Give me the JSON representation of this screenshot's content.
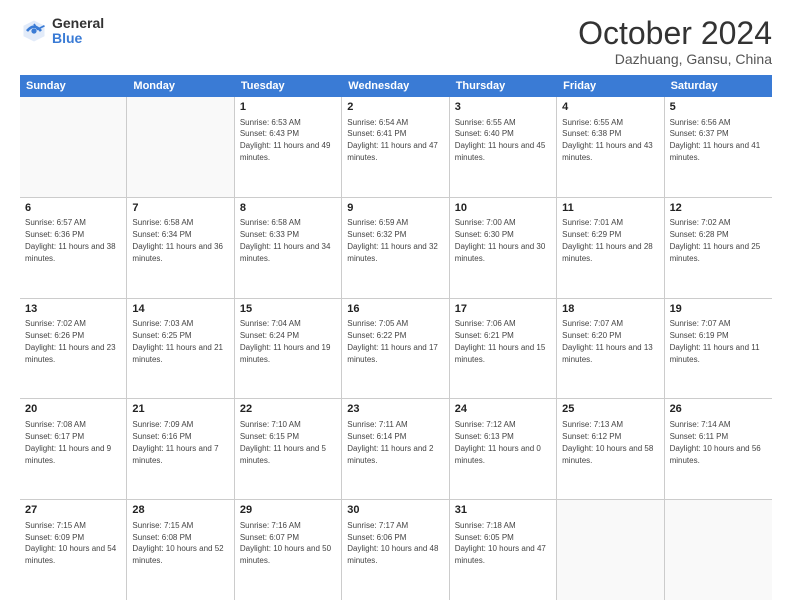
{
  "logo": {
    "general": "General",
    "blue": "Blue"
  },
  "title": "October 2024",
  "location": "Dazhuang, Gansu, China",
  "header_days": [
    "Sunday",
    "Monday",
    "Tuesday",
    "Wednesday",
    "Thursday",
    "Friday",
    "Saturday"
  ],
  "weeks": [
    [
      {
        "day": "",
        "info": ""
      },
      {
        "day": "",
        "info": ""
      },
      {
        "day": "1",
        "info": "Sunrise: 6:53 AM\nSunset: 6:43 PM\nDaylight: 11 hours and 49 minutes."
      },
      {
        "day": "2",
        "info": "Sunrise: 6:54 AM\nSunset: 6:41 PM\nDaylight: 11 hours and 47 minutes."
      },
      {
        "day": "3",
        "info": "Sunrise: 6:55 AM\nSunset: 6:40 PM\nDaylight: 11 hours and 45 minutes."
      },
      {
        "day": "4",
        "info": "Sunrise: 6:55 AM\nSunset: 6:38 PM\nDaylight: 11 hours and 43 minutes."
      },
      {
        "day": "5",
        "info": "Sunrise: 6:56 AM\nSunset: 6:37 PM\nDaylight: 11 hours and 41 minutes."
      }
    ],
    [
      {
        "day": "6",
        "info": "Sunrise: 6:57 AM\nSunset: 6:36 PM\nDaylight: 11 hours and 38 minutes."
      },
      {
        "day": "7",
        "info": "Sunrise: 6:58 AM\nSunset: 6:34 PM\nDaylight: 11 hours and 36 minutes."
      },
      {
        "day": "8",
        "info": "Sunrise: 6:58 AM\nSunset: 6:33 PM\nDaylight: 11 hours and 34 minutes."
      },
      {
        "day": "9",
        "info": "Sunrise: 6:59 AM\nSunset: 6:32 PM\nDaylight: 11 hours and 32 minutes."
      },
      {
        "day": "10",
        "info": "Sunrise: 7:00 AM\nSunset: 6:30 PM\nDaylight: 11 hours and 30 minutes."
      },
      {
        "day": "11",
        "info": "Sunrise: 7:01 AM\nSunset: 6:29 PM\nDaylight: 11 hours and 28 minutes."
      },
      {
        "day": "12",
        "info": "Sunrise: 7:02 AM\nSunset: 6:28 PM\nDaylight: 11 hours and 25 minutes."
      }
    ],
    [
      {
        "day": "13",
        "info": "Sunrise: 7:02 AM\nSunset: 6:26 PM\nDaylight: 11 hours and 23 minutes."
      },
      {
        "day": "14",
        "info": "Sunrise: 7:03 AM\nSunset: 6:25 PM\nDaylight: 11 hours and 21 minutes."
      },
      {
        "day": "15",
        "info": "Sunrise: 7:04 AM\nSunset: 6:24 PM\nDaylight: 11 hours and 19 minutes."
      },
      {
        "day": "16",
        "info": "Sunrise: 7:05 AM\nSunset: 6:22 PM\nDaylight: 11 hours and 17 minutes."
      },
      {
        "day": "17",
        "info": "Sunrise: 7:06 AM\nSunset: 6:21 PM\nDaylight: 11 hours and 15 minutes."
      },
      {
        "day": "18",
        "info": "Sunrise: 7:07 AM\nSunset: 6:20 PM\nDaylight: 11 hours and 13 minutes."
      },
      {
        "day": "19",
        "info": "Sunrise: 7:07 AM\nSunset: 6:19 PM\nDaylight: 11 hours and 11 minutes."
      }
    ],
    [
      {
        "day": "20",
        "info": "Sunrise: 7:08 AM\nSunset: 6:17 PM\nDaylight: 11 hours and 9 minutes."
      },
      {
        "day": "21",
        "info": "Sunrise: 7:09 AM\nSunset: 6:16 PM\nDaylight: 11 hours and 7 minutes."
      },
      {
        "day": "22",
        "info": "Sunrise: 7:10 AM\nSunset: 6:15 PM\nDaylight: 11 hours and 5 minutes."
      },
      {
        "day": "23",
        "info": "Sunrise: 7:11 AM\nSunset: 6:14 PM\nDaylight: 11 hours and 2 minutes."
      },
      {
        "day": "24",
        "info": "Sunrise: 7:12 AM\nSunset: 6:13 PM\nDaylight: 11 hours and 0 minutes."
      },
      {
        "day": "25",
        "info": "Sunrise: 7:13 AM\nSunset: 6:12 PM\nDaylight: 10 hours and 58 minutes."
      },
      {
        "day": "26",
        "info": "Sunrise: 7:14 AM\nSunset: 6:11 PM\nDaylight: 10 hours and 56 minutes."
      }
    ],
    [
      {
        "day": "27",
        "info": "Sunrise: 7:15 AM\nSunset: 6:09 PM\nDaylight: 10 hours and 54 minutes."
      },
      {
        "day": "28",
        "info": "Sunrise: 7:15 AM\nSunset: 6:08 PM\nDaylight: 10 hours and 52 minutes."
      },
      {
        "day": "29",
        "info": "Sunrise: 7:16 AM\nSunset: 6:07 PM\nDaylight: 10 hours and 50 minutes."
      },
      {
        "day": "30",
        "info": "Sunrise: 7:17 AM\nSunset: 6:06 PM\nDaylight: 10 hours and 48 minutes."
      },
      {
        "day": "31",
        "info": "Sunrise: 7:18 AM\nSunset: 6:05 PM\nDaylight: 10 hours and 47 minutes."
      },
      {
        "day": "",
        "info": ""
      },
      {
        "day": "",
        "info": ""
      }
    ]
  ]
}
